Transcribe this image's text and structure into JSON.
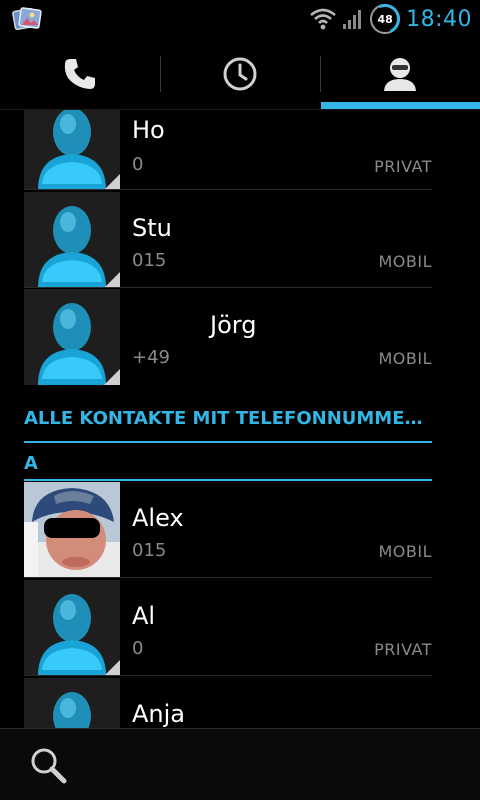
{
  "status_bar": {
    "time": "18:40",
    "battery_level": "48",
    "notification_icon": "gallery-icon",
    "accent_color": "#33b5e5"
  },
  "tabs": [
    {
      "name": "phone",
      "icon": "phone-icon"
    },
    {
      "name": "call-log",
      "icon": "clock-icon"
    },
    {
      "name": "contacts",
      "icon": "person-icon",
      "selected": true
    }
  ],
  "favorites": [
    {
      "name": "Ho",
      "number": "0",
      "type": "PRIVAT"
    },
    {
      "name": "Stu",
      "number": "015",
      "type": "MOBIL"
    },
    {
      "name": "Jörg",
      "number": "+49",
      "type": "MOBIL"
    }
  ],
  "all_contacts_header": "ALLE KONTAKTE MIT TELEFONNUMME…",
  "letter_header": "A",
  "contacts": [
    {
      "name": "Alex",
      "number": "015",
      "type": "MOBIL",
      "has_photo": true
    },
    {
      "name": "Al",
      "number": "0",
      "type": "PRIVAT"
    },
    {
      "name": "Anja",
      "number": "",
      "type": ""
    }
  ],
  "bottom_bar": {
    "search_icon": "search-icon"
  }
}
